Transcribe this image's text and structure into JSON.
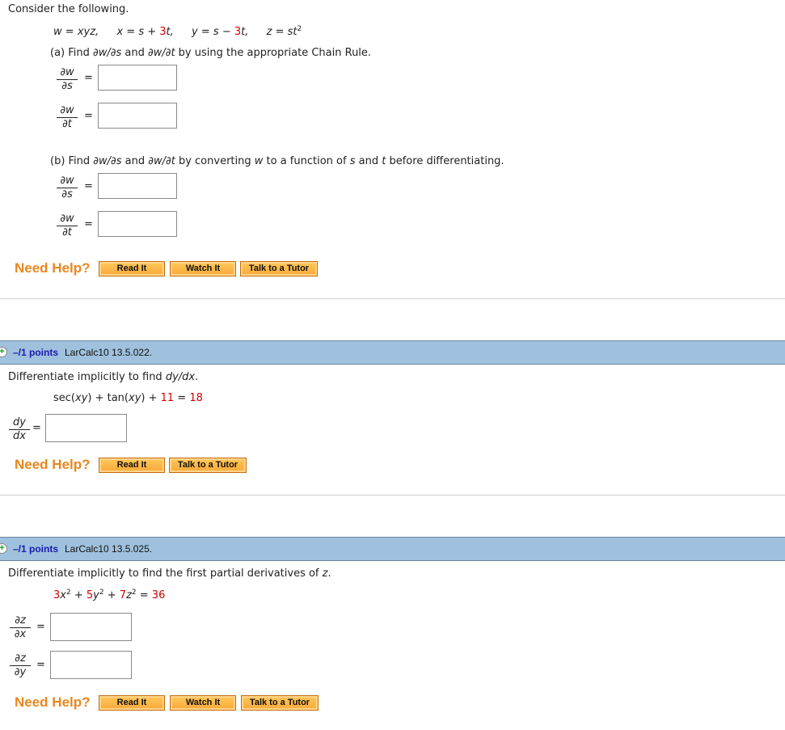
{
  "q1": {
    "intro": "Consider the following.",
    "equations": {
      "w": {
        "lhs": "w",
        "rhs": "xyz,"
      },
      "x": {
        "lhs": "x",
        "rhs_pre": "s + ",
        "coef": "3",
        "var": "t,"
      },
      "y": {
        "lhs": "y",
        "rhs_pre": "s − ",
        "coef": "3",
        "var": "t,"
      },
      "z": {
        "lhs": "z",
        "rhs": "st",
        "exp": "2"
      }
    },
    "part_a": {
      "prefix": "(a) Find ",
      "expr1": "∂w/∂s",
      "mid": " and ",
      "expr2": "∂w/∂t",
      "suffix": " by using the appropriate Chain Rule.",
      "answers": [
        {
          "num": "∂w",
          "den": "∂s",
          "value": ""
        },
        {
          "num": "∂w",
          "den": "∂t",
          "value": ""
        }
      ]
    },
    "part_b": {
      "prefix": "(b) Find ",
      "expr1": "∂w/∂s",
      "mid": " and ",
      "expr2": "∂w/∂t",
      "text1": " by converting ",
      "var_w": "w",
      "text2": " to a function of ",
      "var_s": "s",
      "text3": " and ",
      "var_t": "t",
      "text4": " before differentiating.",
      "answers": [
        {
          "num": "∂w",
          "den": "∂s",
          "value": ""
        },
        {
          "num": "∂w",
          "den": "∂t",
          "value": ""
        }
      ]
    },
    "help": {
      "label": "Need Help?",
      "buttons": [
        "Read It",
        "Watch It",
        "Talk to a Tutor"
      ]
    }
  },
  "q2": {
    "header": {
      "points": "–/1 points",
      "id": "LarCalc10 13.5.022."
    },
    "prompt_pre": "Differentiate implicitly to find ",
    "prompt_expr": "dy/dx",
    "prompt_post": ".",
    "equation": {
      "part1": "sec(",
      "xy1": "xy",
      "part2": ") + tan(",
      "xy2": "xy",
      "part3": ") + ",
      "c1": "11",
      "eq": " = ",
      "c2": "18"
    },
    "answer": {
      "num": "dy",
      "den": "dx",
      "value": ""
    },
    "help": {
      "label": "Need Help?",
      "buttons": [
        "Read It",
        "Talk to a Tutor"
      ]
    }
  },
  "q3": {
    "header": {
      "points": "–/1 points",
      "id": "LarCalc10 13.5.025."
    },
    "prompt_pre": "Differentiate implicitly to find the first partial derivatives of ",
    "prompt_var": "z",
    "prompt_post": ".",
    "equation": {
      "c1": "3",
      "v1": "x",
      "c2": "5",
      "v2": "y",
      "c3": "7",
      "v3": "z",
      "exp": "2",
      "plus": " + ",
      "eq": " = ",
      "rhs": "36"
    },
    "answers": [
      {
        "num": "∂z",
        "den": "∂x",
        "value": ""
      },
      {
        "num": "∂z",
        "den": "∂y",
        "value": ""
      }
    ],
    "help": {
      "label": "Need Help?",
      "buttons": [
        "Read It",
        "Watch It",
        "Talk to a Tutor"
      ]
    }
  },
  "colors": {
    "accent_orange": "#e8871e",
    "header_blue": "#9fc1dd",
    "points_blue": "#1a1ab0",
    "constant_red": "#d40000"
  }
}
